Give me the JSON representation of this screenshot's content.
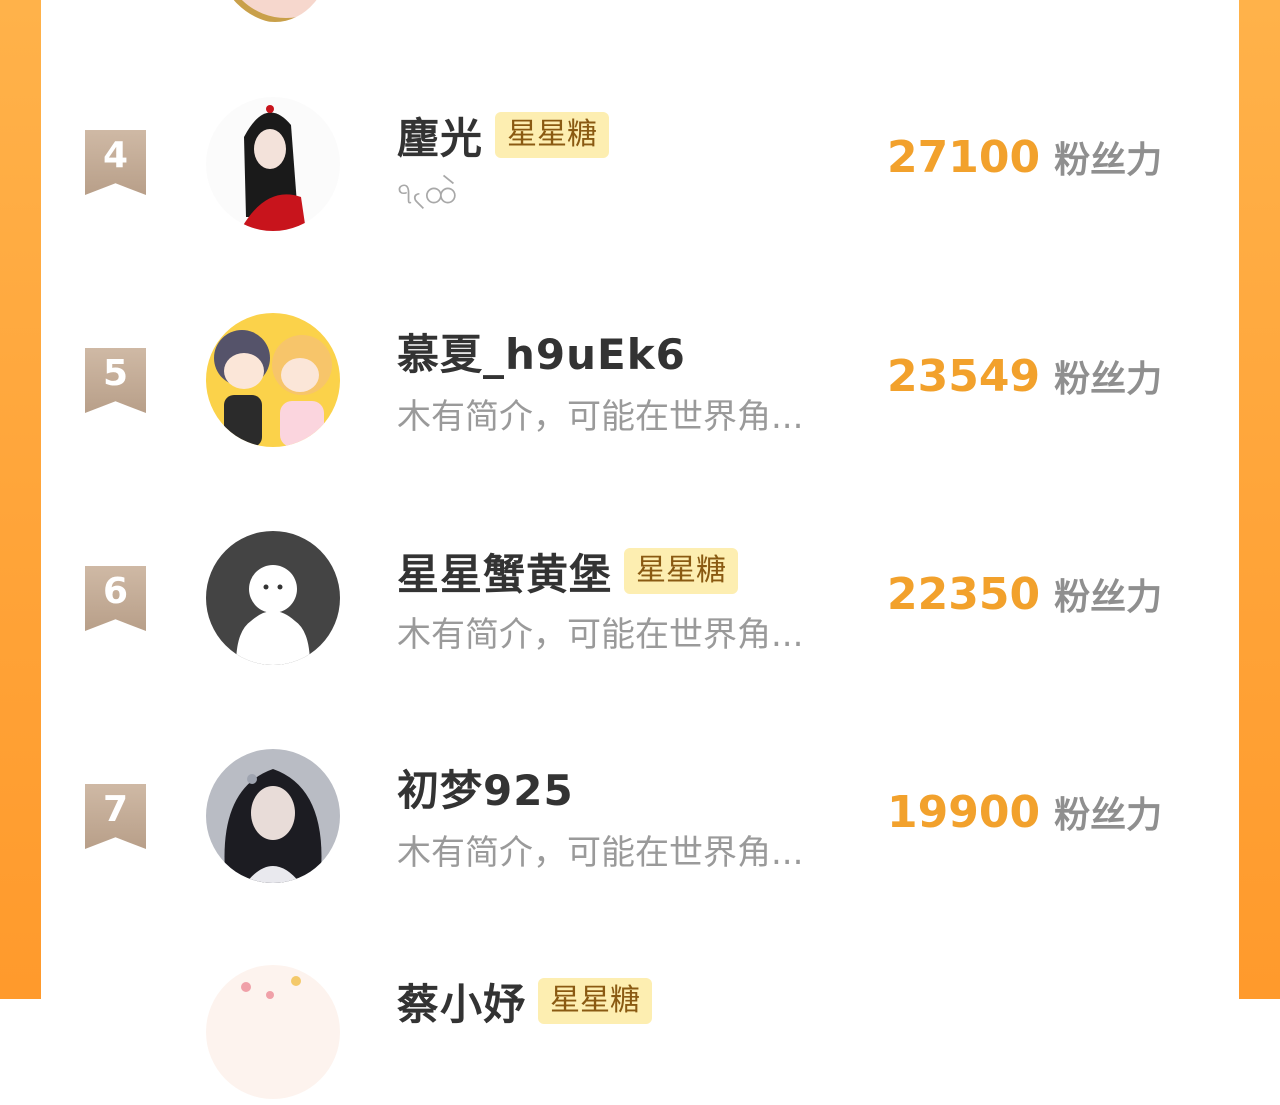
{
  "score_unit": "粉丝力",
  "rows": [
    {
      "rank": "4",
      "name": "麈光",
      "badge": "星星糖",
      "bio": "ঀ৻ထဲ",
      "score": "27100"
    },
    {
      "rank": "5",
      "name": "慕夏_h9uEk6",
      "badge": "",
      "bio": "木有简介，可能在世界角...",
      "score": "23549"
    },
    {
      "rank": "6",
      "name": "星星蟹黄堡",
      "badge": "星星糖",
      "bio": "木有简介，可能在世界角...",
      "score": "22350"
    },
    {
      "rank": "7",
      "name": "初梦925",
      "badge": "",
      "bio": "木有简介，可能在世界角...",
      "score": "19900"
    },
    {
      "rank": "",
      "name": "蔡小妤",
      "badge": "星星糖",
      "bio": "",
      "score": ""
    }
  ],
  "colors": {
    "accent": "#f2a12c",
    "side": "#ffa53a",
    "badge_bg": "#fdeeb1"
  }
}
